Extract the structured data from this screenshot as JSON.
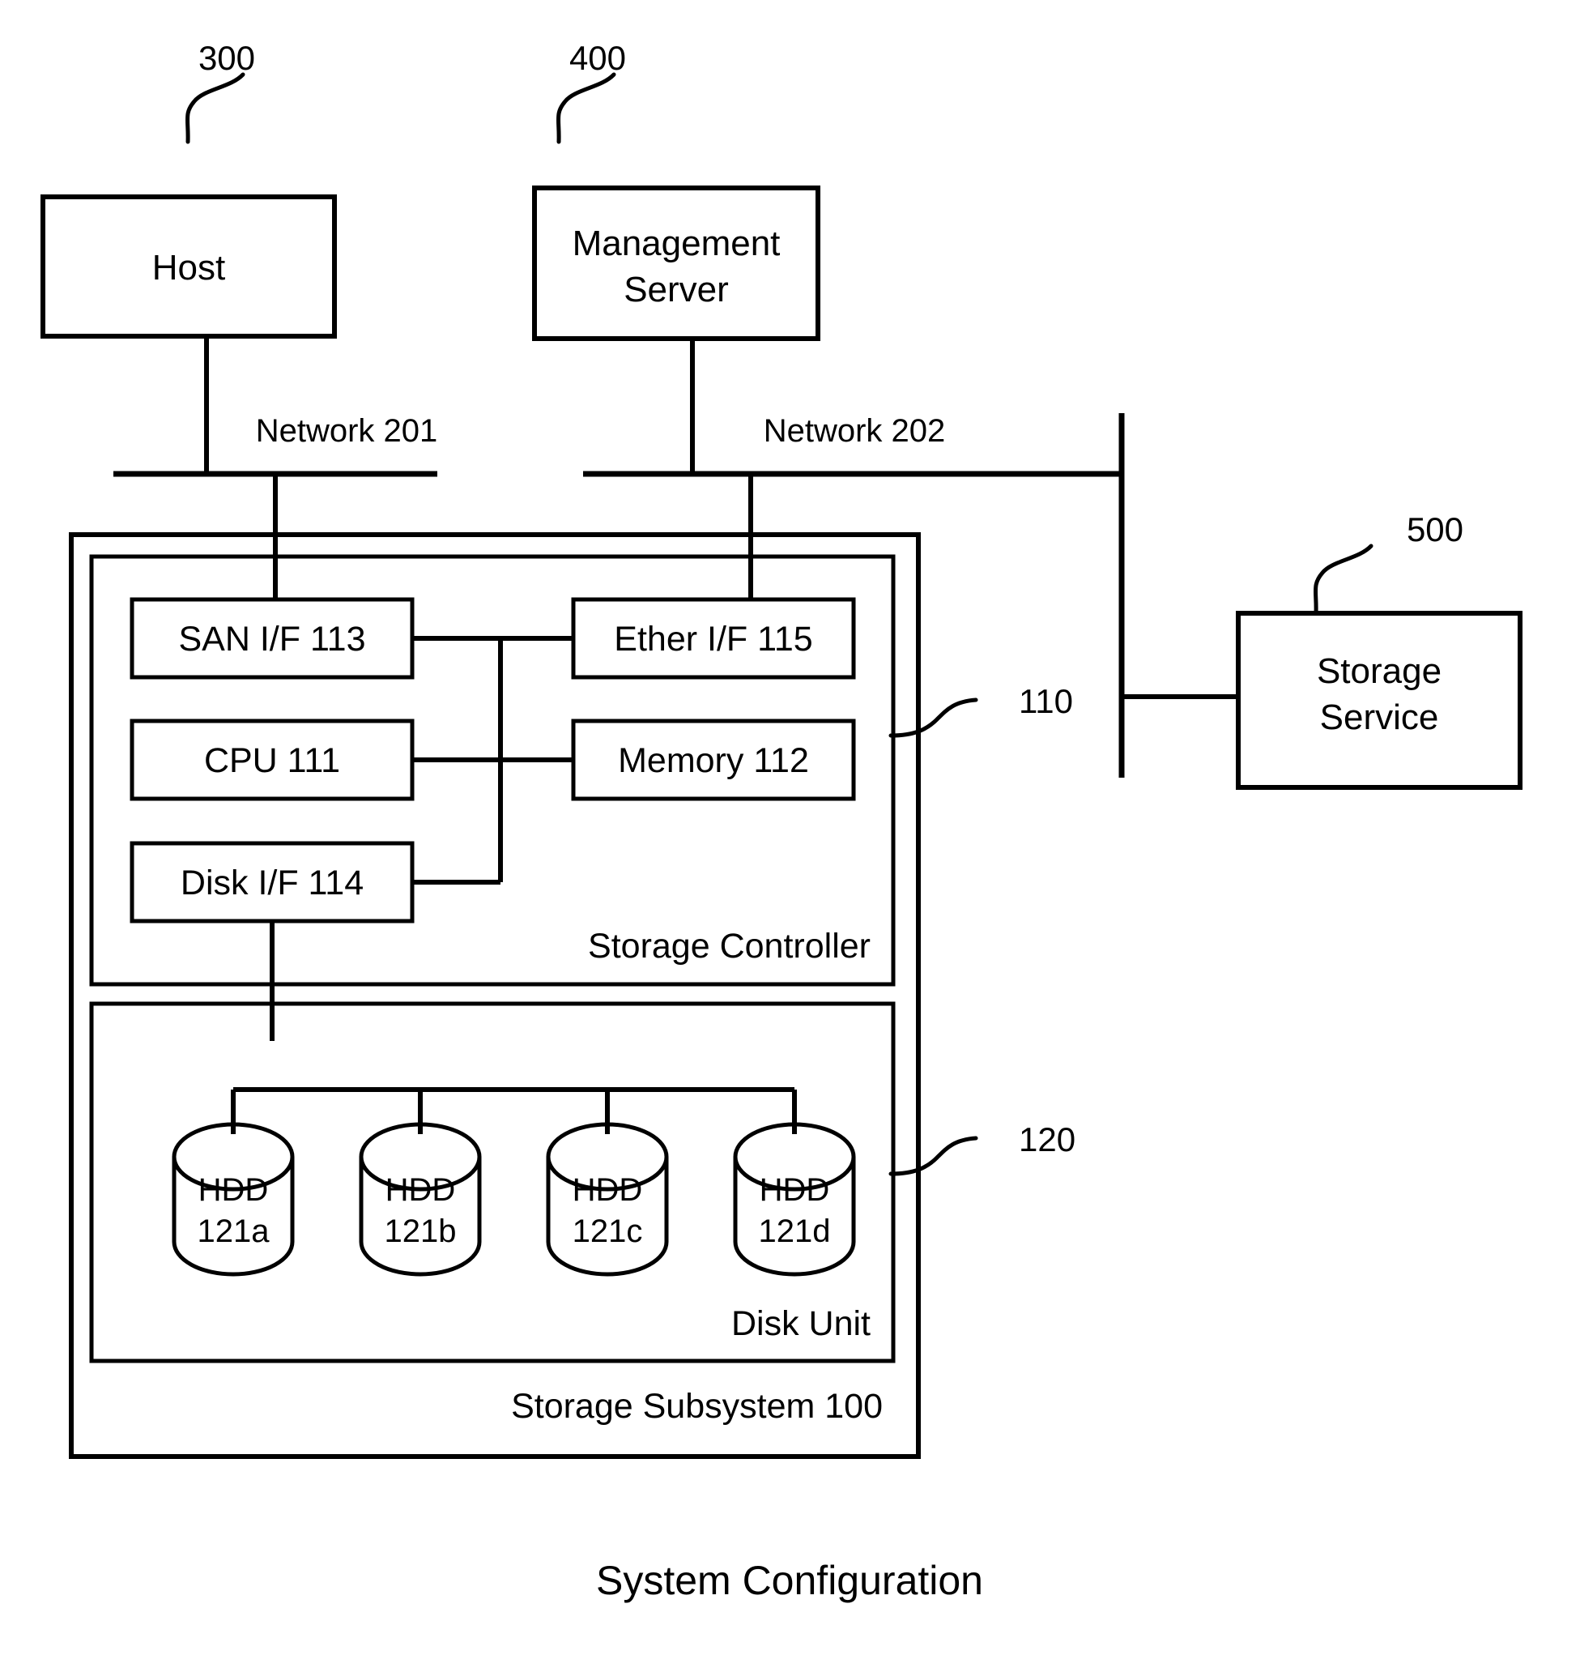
{
  "figure": {
    "title": "System Configuration",
    "nodes": {
      "host": {
        "label": "Host",
        "ref": "300"
      },
      "management_server": {
        "label_line1": "Management",
        "label_line2": "Server",
        "ref": "400"
      },
      "storage_service": {
        "label_line1": "Storage",
        "label_line2": "Service",
        "ref": "500"
      }
    },
    "networks": [
      {
        "label": "Network 201"
      },
      {
        "label": "Network 202"
      }
    ],
    "storage_subsystem": {
      "label": "Storage Subsystem 100",
      "controller": {
        "label": "Storage Controller",
        "ref": "110",
        "components": [
          {
            "label": "SAN I/F 113"
          },
          {
            "label": "Ether I/F 115"
          },
          {
            "label": "CPU 111"
          },
          {
            "label": "Memory 112"
          },
          {
            "label": "Disk I/F 114"
          }
        ]
      },
      "disk_unit": {
        "label": "Disk Unit",
        "ref": "120",
        "disks": [
          {
            "line1": "HDD",
            "line2": "121a"
          },
          {
            "line1": "HDD",
            "line2": "121b"
          },
          {
            "line1": "HDD",
            "line2": "121c"
          },
          {
            "line1": "HDD",
            "line2": "121d"
          }
        ]
      }
    }
  }
}
